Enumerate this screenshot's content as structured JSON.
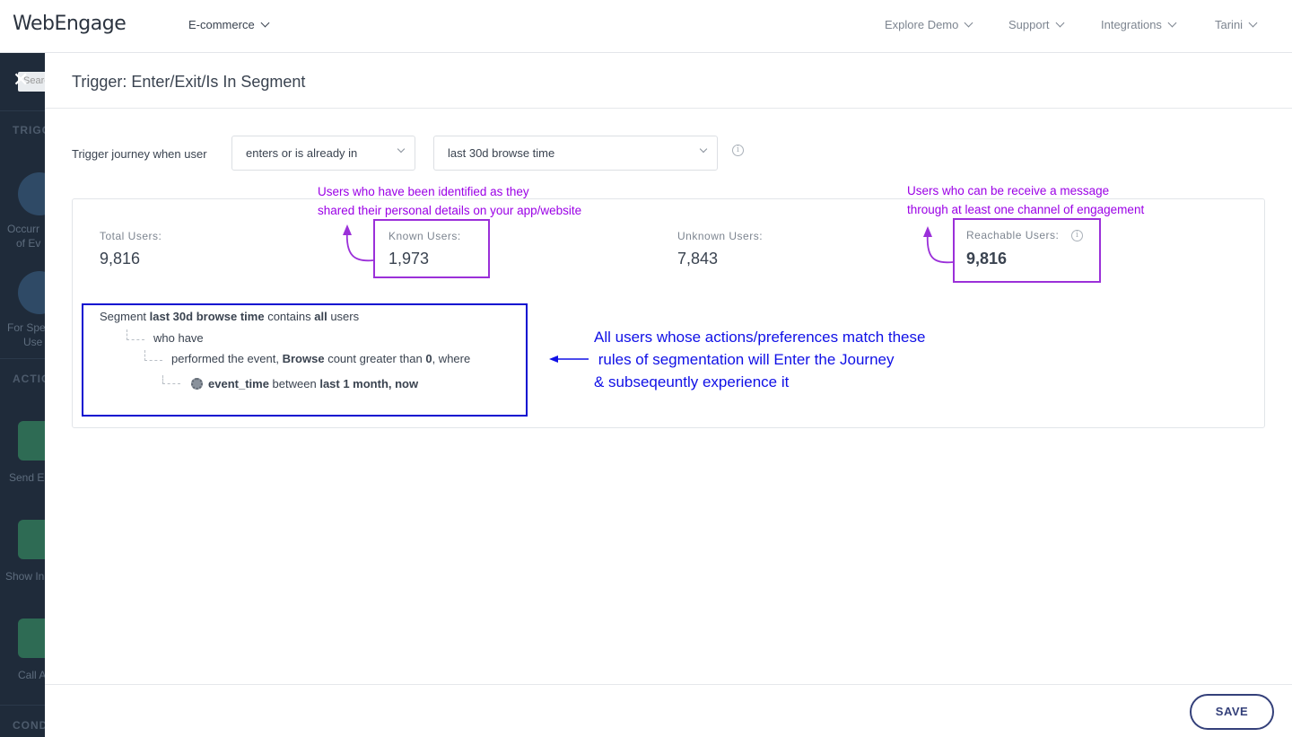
{
  "topbar": {
    "logo": "WebEngage",
    "project": "E-commerce",
    "nav": [
      "Explore Demo",
      "Support",
      "Integrations",
      "Tarini"
    ]
  },
  "sidebar": {
    "search_placeholder": "Search",
    "section_trigger": "TRIGG",
    "item1_caption_a": "Occurr",
    "item1_caption_b": "of Ev",
    "item2_caption_a": "For Spe",
    "item2_caption_b": "Use",
    "section_actions": "ACTIO",
    "item3_caption": "Send E",
    "item4_caption": "Show In",
    "item5_caption": "Call A",
    "section_conditions": "COND"
  },
  "modal": {
    "title": "Trigger: Enter/Exit/Is In Segment",
    "trigger_label": "Trigger journey when user",
    "condition_select": "enters or is already in",
    "segment_select": "last 30d browse time",
    "stats": {
      "total_label": "Total Users:",
      "total_value": "9,816",
      "known_label": "Known Users:",
      "known_value": "1,973",
      "unknown_label": "Unknown Users:",
      "unknown_value": "7,843",
      "reachable_label": "Reachable Users:",
      "reachable_value": "9,816"
    },
    "segment": {
      "prefix": "Segment",
      "name": "last 30d browse time",
      "contains": "contains",
      "all": "all",
      "users": "users",
      "who_have": "who have",
      "performed_prefix": "performed the event,",
      "event_name": "Browse",
      "count_text": "count greater than",
      "count_value": "0",
      "where": ", where",
      "attr": "event_time",
      "between": "between",
      "range": "last 1 month, now"
    },
    "save_label": "SAVE"
  },
  "annotations": {
    "known_line1": "Users who have been identified as they",
    "known_line2": "shared their personal details on your app/website",
    "reach_line1": "Users who can be receive a message",
    "reach_line2": "through at least one channel of engagement",
    "seg_line1": "All users whose actions/preferences match these",
    "seg_line2": " rules of segmentation will Enter the Journey",
    "seg_line3": "& subseqeuntly experience it"
  },
  "colors": {
    "annotation_purple": "#9b00e6",
    "annotation_blue": "#1010e6",
    "sidebar_bg": "#1f2b3a",
    "save_border": "#34407a"
  }
}
